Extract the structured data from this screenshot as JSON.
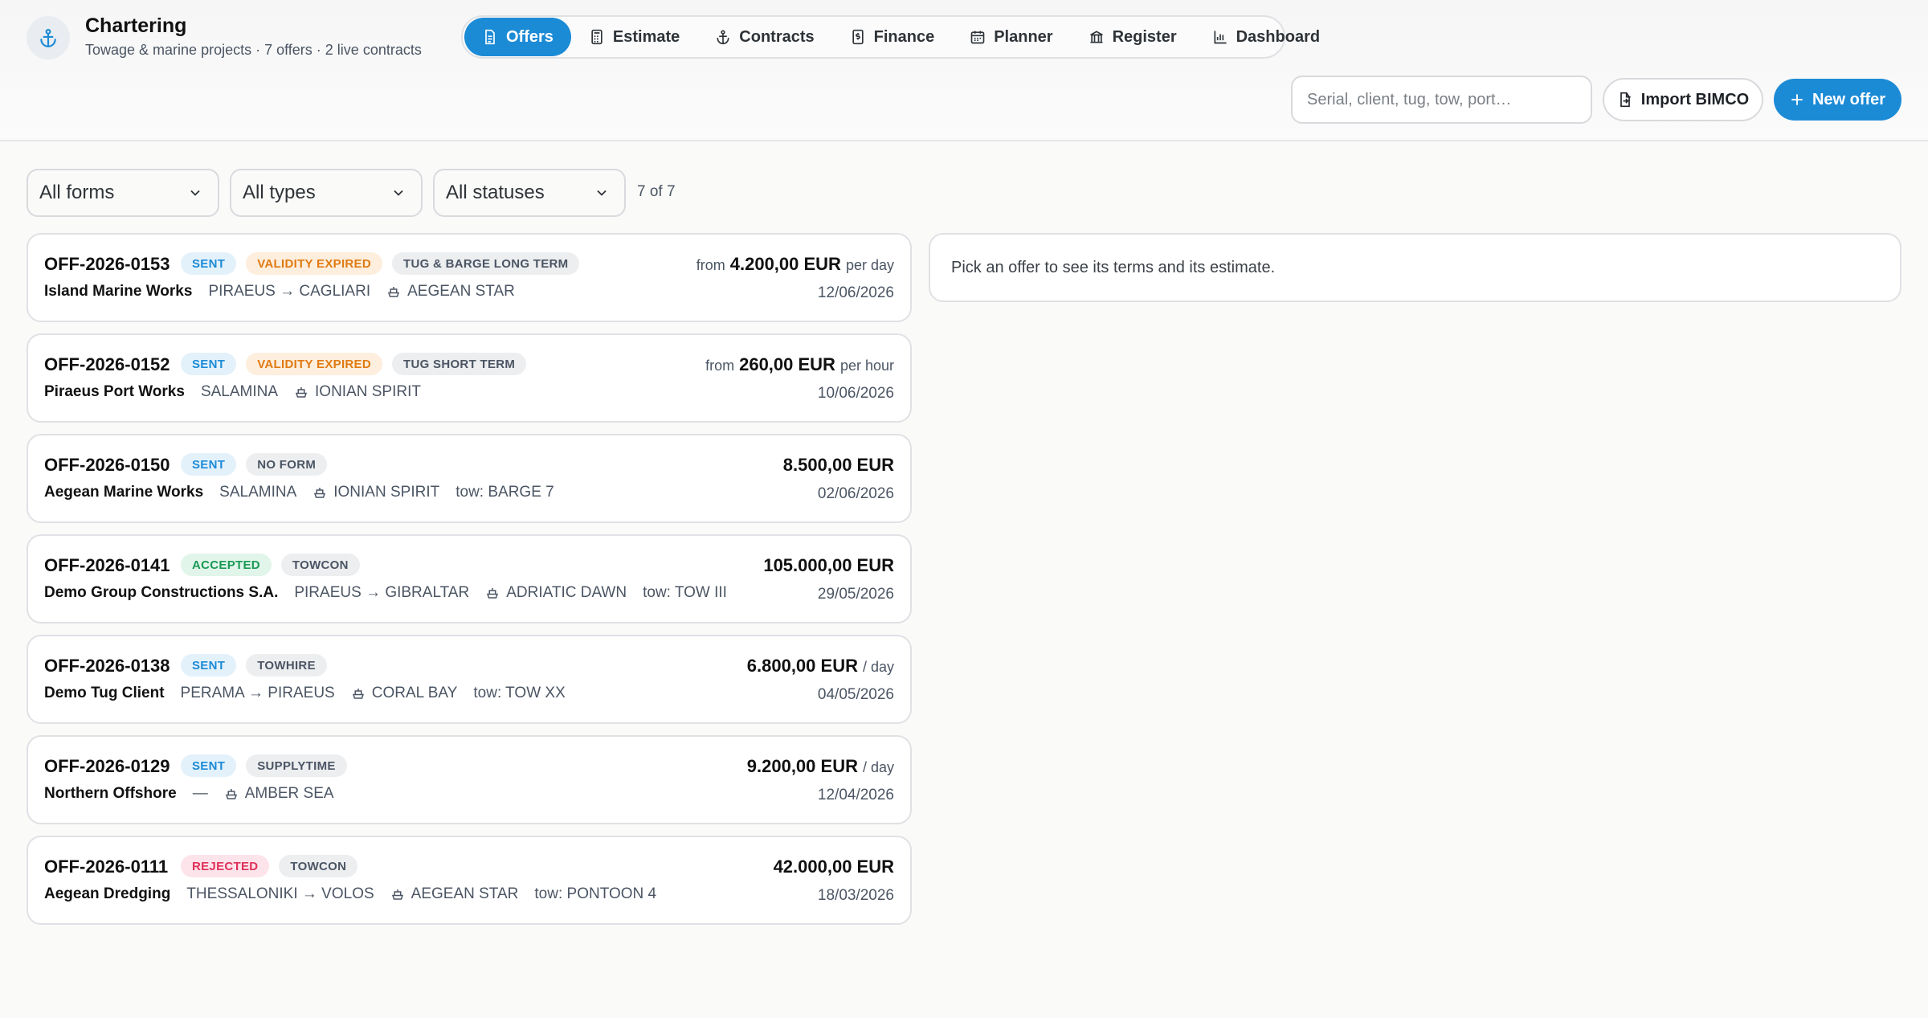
{
  "app": {
    "title": "Chartering",
    "subtitle": "Towage & marine projects · 7 offers · 2 live contracts"
  },
  "tabs": [
    {
      "label": "Offers",
      "icon": "document-icon",
      "active": true
    },
    {
      "label": "Estimate",
      "icon": "calculator-icon",
      "active": false
    },
    {
      "label": "Contracts",
      "icon": "anchor-icon",
      "active": false
    },
    {
      "label": "Finance",
      "icon": "dollar-doc-icon",
      "active": false
    },
    {
      "label": "Planner",
      "icon": "calendar-icon",
      "active": false
    },
    {
      "label": "Register",
      "icon": "bank-icon",
      "active": false
    },
    {
      "label": "Dashboard",
      "icon": "bar-chart-icon",
      "active": false
    }
  ],
  "search": {
    "placeholder": "Serial, client, tug, tow, port…"
  },
  "actions": {
    "import_label": "Import BIMCO",
    "new_label": "New offer"
  },
  "filters": {
    "forms": "All forms",
    "types": "All types",
    "statuses": "All statuses",
    "count": "7 of 7"
  },
  "offers": [
    {
      "serial": "OFF-2026-0153",
      "status": "SENT",
      "tags": [
        "VALIDITY EXPIRED",
        "TUG & BARGE LONG TERM"
      ],
      "client": "Island Marine Works",
      "route": "PIRAEUS → CAGLIARI",
      "vessel": "AEGEAN STAR",
      "tow": "",
      "price_prefix": "from",
      "amount": "4.200,00 EUR",
      "price_suffix": "per day",
      "date": "12/06/2026"
    },
    {
      "serial": "OFF-2026-0152",
      "status": "SENT",
      "tags": [
        "VALIDITY EXPIRED",
        "TUG SHORT TERM"
      ],
      "client": "Piraeus Port Works",
      "route": "SALAMINA",
      "vessel": "IONIAN SPIRIT",
      "tow": "",
      "price_prefix": "from",
      "amount": "260,00 EUR",
      "price_suffix": "per hour",
      "date": "10/06/2026"
    },
    {
      "serial": "OFF-2026-0150",
      "status": "SENT",
      "tags": [
        "NO FORM"
      ],
      "client": "Aegean Marine Works",
      "route": "SALAMINA",
      "vessel": "IONIAN SPIRIT",
      "tow": "tow: BARGE 7",
      "price_prefix": "",
      "amount": "8.500,00 EUR",
      "price_suffix": "",
      "date": "02/06/2026"
    },
    {
      "serial": "OFF-2026-0141",
      "status": "ACCEPTED",
      "tags": [
        "TOWCON"
      ],
      "client": "Demo Group Constructions S.A.",
      "route": "PIRAEUS → GIBRALTAR",
      "vessel": "ADRIATIC DAWN",
      "tow": "tow: TOW III",
      "price_prefix": "",
      "amount": "105.000,00 EUR",
      "price_suffix": "",
      "date": "29/05/2026"
    },
    {
      "serial": "OFF-2026-0138",
      "status": "SENT",
      "tags": [
        "TOWHIRE"
      ],
      "client": "Demo Tug Client",
      "route": "PERAMA → PIRAEUS",
      "vessel": "CORAL BAY",
      "tow": "tow: TOW XX",
      "price_prefix": "",
      "amount": "6.800,00 EUR",
      "price_suffix": "/ day",
      "date": "04/05/2026"
    },
    {
      "serial": "OFF-2026-0129",
      "status": "SENT",
      "tags": [
        "SUPPLYTIME"
      ],
      "client": "Northern Offshore",
      "route": "—",
      "vessel": "AMBER SEA",
      "tow": "",
      "price_prefix": "",
      "amount": "9.200,00 EUR",
      "price_suffix": "/ day",
      "date": "12/04/2026"
    },
    {
      "serial": "OFF-2026-0111",
      "status": "REJECTED",
      "tags": [
        "TOWCON"
      ],
      "client": "Aegean Dredging",
      "route": "THESSALONIKI → VOLOS",
      "vessel": "AEGEAN STAR",
      "tow": "tow: PONTOON 4",
      "price_prefix": "",
      "amount": "42.000,00 EUR",
      "price_suffix": "",
      "date": "18/03/2026"
    }
  ],
  "detail": {
    "placeholder": "Pick an offer to see its terms and its estimate."
  },
  "colors": {
    "accent": "#1c8bd6",
    "sent": "#1c8bd6",
    "expired": "#e07b12",
    "accepted": "#1a9a55",
    "rejected": "#e0305a"
  }
}
